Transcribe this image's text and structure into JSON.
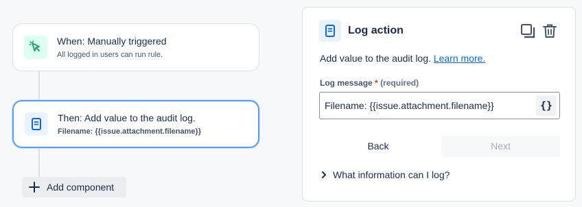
{
  "flow": {
    "trigger": {
      "icon": "cursor-click-icon",
      "title": "When: Manually triggered",
      "subtitle": "All logged in users can run rule."
    },
    "action": {
      "icon": "document-icon",
      "title": "Then: Add value to the audit log.",
      "subtitle": "Filename: {{issue.attachment.filename}}",
      "selected": true
    },
    "add_component_label": "Add component"
  },
  "panel": {
    "icon": "document-icon",
    "title": "Log action",
    "description": "Add value to the audit log.",
    "learn_more": "Learn more.",
    "field": {
      "label": "Log message",
      "required_mark": "*",
      "required_text": "(required)",
      "value": "Filename: {{issue.attachment.filename}}",
      "smart_values_button": "{}"
    },
    "back_label": "Back",
    "next_label": "Next",
    "expander_label": "What information can I log?"
  },
  "colors": {
    "accent": "#579dff",
    "link": "#0c66e4",
    "trigger_icon": "#22a06b",
    "action_icon": "#0c66e4",
    "required": "#c9372c"
  }
}
